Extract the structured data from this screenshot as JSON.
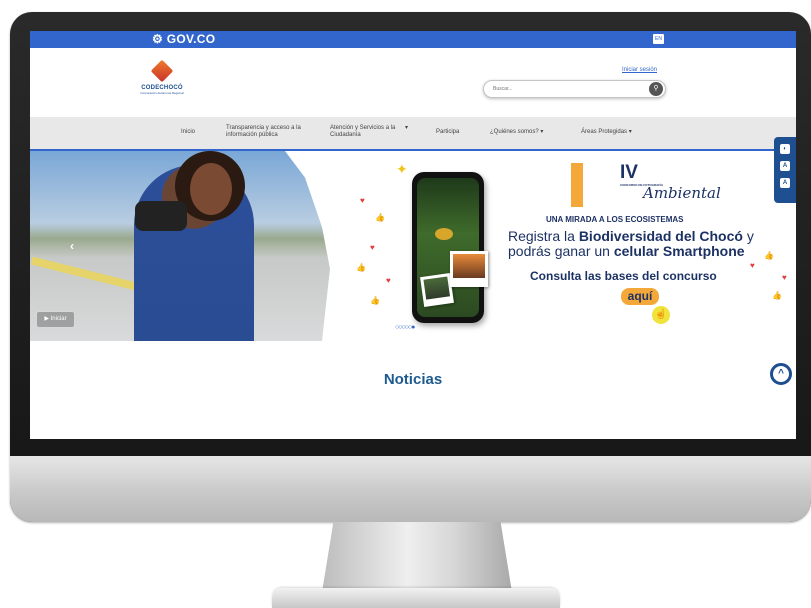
{
  "govbar": {
    "logo_text": "GOV.CO",
    "lang_button": "EN"
  },
  "header": {
    "logo_name": "CODECHOCÓ",
    "logo_sub": "Corporación Autónoma Regional",
    "login_link": "Iniciar sesión",
    "search_placeholder": "Buscar..."
  },
  "nav": {
    "items": [
      {
        "label": "Inicio"
      },
      {
        "label": "Transparencia y acceso a la información pública"
      },
      {
        "label": "Atención y Servicios a la Ciudadanía",
        "dropdown": true
      },
      {
        "label": "Participa"
      },
      {
        "label": "¿Quiénes somos?",
        "dropdown": true
      },
      {
        "label": "Áreas Protegidas",
        "dropdown": true
      }
    ]
  },
  "hero": {
    "play_button": "Iniciar",
    "badge_numeral": "IV",
    "badge_sub": "CONCURSO DE FOTOGRAFÍA",
    "badge_script": "Ambiental",
    "tagline": "UNA MIRADA A LOS ECOSISTEMAS",
    "line1_pre": "Registra la ",
    "line1_bold": "Biodiversidad del Chocó",
    "line1_post": " y",
    "line2_pre": "podrás ganar un ",
    "line2_bold": "celular Smartphone",
    "consulta": "Consulta las bases del concurso",
    "aqui": "aquí",
    "dots": "○○○○○●"
  },
  "section": {
    "news_title": "Noticias"
  },
  "colors": {
    "gov_blue": "#3366cc",
    "brand_navy": "#1d3264",
    "accent_orange": "#f4a83a"
  },
  "icons": {
    "prev": "chevron-left-icon",
    "play": "play-icon",
    "search": "search-icon",
    "contrast": "contrast-icon",
    "text_smaller": "text-decrease-icon",
    "text_bigger": "text-increase-icon",
    "to_top": "chevron-up-icon"
  }
}
